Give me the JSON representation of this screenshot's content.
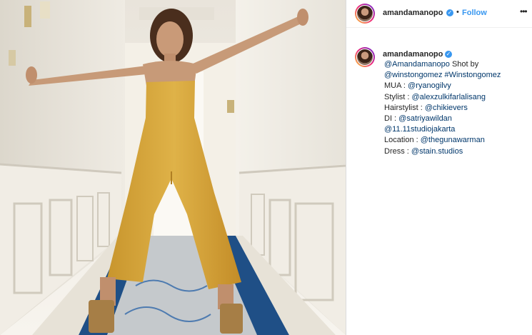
{
  "post": {
    "username": "amandamanopo",
    "follow_label": "Follow",
    "separator": "•",
    "more_label": "•••",
    "verified_glyph": "✓"
  },
  "caption": {
    "username": "amandamanopo",
    "lines": [
      {
        "mention": "@Amandamanopo",
        "text": " Shot by"
      },
      {
        "mention": "@winstongomez",
        "text": " ",
        "tag": "#Winstongomez"
      },
      {
        "label": "MUA : ",
        "mention": "@ryanogilvy"
      },
      {
        "label": "Stylist : ",
        "mention": "@alexzulkifarlalisang"
      },
      {
        "label": "Hairstylist : ",
        "mention": "@chikievers"
      },
      {
        "label": "DI : ",
        "mention": "@satriyawildan"
      },
      {
        "mention": "@11.11studiojakarta"
      },
      {
        "label": "Location : ",
        "mention": "@thegunawarman"
      },
      {
        "label": "Dress : ",
        "mention": "@stain.studios"
      }
    ]
  },
  "colors": {
    "link": "#00376b",
    "follow": "#3897f0",
    "verified": "#3897f0",
    "jumpsuit": "#d9a93c"
  },
  "icons": {
    "verified": "verified-badge-icon",
    "more": "more-options-icon"
  }
}
